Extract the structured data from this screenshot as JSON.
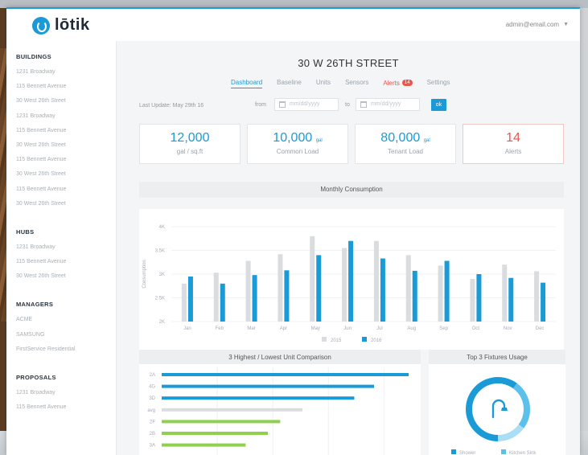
{
  "app": {
    "logo": "lōtik",
    "account": "admin@email.com"
  },
  "sidebar": {
    "sections": [
      {
        "title": "BUILDINGS",
        "items": [
          "1231 Broadway",
          "115 Bennett Avenue",
          "30 West 26th Street",
          "1231 Broadway",
          "115 Bennett Avenue",
          "30 West 26th Street",
          "115 Bennett Avenue",
          "30 West 26th Street",
          "115 Bennett Avenue",
          "30 West 26th Street"
        ]
      },
      {
        "title": "HUBS",
        "items": [
          "1231 Broadway",
          "115 Bennett Avenue",
          "30 West 26th Street"
        ]
      },
      {
        "title": "MANAGERS",
        "items": [
          "ACME",
          "SAMSUNG",
          "FirstService Residential"
        ]
      },
      {
        "title": "PROPOSALS",
        "items": [
          "1231 Broadway",
          "115 Bennett Avenue"
        ]
      }
    ]
  },
  "page": {
    "title": "30 W 26TH STREET"
  },
  "tabs": [
    {
      "label": "Dashboard",
      "active": true
    },
    {
      "label": "Baseline"
    },
    {
      "label": "Units"
    },
    {
      "label": "Sensors"
    },
    {
      "label": "Alerts",
      "badge": "14"
    },
    {
      "label": "Settings"
    }
  ],
  "filter": {
    "last_update": "Last Update: May 29th 16",
    "from_label": "from",
    "to_label": "to",
    "from_placeholder": "mm/dd/yyyy",
    "to_placeholder": "mm/dd/yyyy",
    "ok_label": "ok"
  },
  "stats": [
    {
      "value": "12,000",
      "unit": "",
      "label": "gal / sq.ft"
    },
    {
      "value": "10,000",
      "unit": "gal",
      "label": "Common Load"
    },
    {
      "value": "80,000",
      "unit": "gal",
      "label": "Tenant Load"
    },
    {
      "value": "14",
      "unit": "",
      "label": "Alerts"
    }
  ],
  "panels": {
    "monthly": "Monthly Consumption",
    "comparison": "3 Highest / Lowest Unit Comparison",
    "fixtures": "Top 3 Fixtures Usage"
  },
  "colors": {
    "accent": "#1a9bd7",
    "alert": "#e8564d",
    "gray_series": "#d9dde0",
    "green": "#8fd14f"
  },
  "chart_data": [
    {
      "type": "bar",
      "title": "Monthly Consumption",
      "ylabel": "Consumption",
      "xlabel": "",
      "categories": [
        "Jan",
        "Feb",
        "Mar",
        "Apr",
        "May",
        "Jun",
        "Jul",
        "Aug",
        "Sep",
        "Oct",
        "Nov",
        "Dec"
      ],
      "series": [
        {
          "name": "2015",
          "color": "#d9dde0",
          "values": [
            2.8,
            3.03,
            3.28,
            3.42,
            3.8,
            3.55,
            3.7,
            3.4,
            3.18,
            2.9,
            3.2,
            3.06
          ]
        },
        {
          "name": "2016",
          "color": "#1a9bd7",
          "values": [
            2.95,
            2.8,
            2.98,
            3.08,
            3.4,
            3.7,
            3.33,
            3.07,
            3.28,
            3.0,
            2.92,
            2.82
          ]
        }
      ],
      "yticks": [
        "2K",
        "2.5K",
        "3K",
        "3.5K",
        "4K"
      ],
      "ylim": [
        2.0,
        4.0
      ],
      "legend": "bottom"
    },
    {
      "type": "bar",
      "orientation": "horizontal",
      "title": "3 Highest / Lowest Unit Comparison",
      "categories": [
        "2A",
        "4G",
        "3D",
        "avg",
        "2F",
        "2B",
        "3A"
      ],
      "values": [
        100,
        86,
        78,
        57,
        48,
        43,
        34
      ],
      "colors": [
        "#1a9bd7",
        "#1a9bd7",
        "#1a9bd7",
        "#d9dde0",
        "#8fd14f",
        "#8fd14f",
        "#8fd14f"
      ],
      "xlim": [
        0,
        100
      ]
    },
    {
      "type": "pie",
      "title": "Top 3 Fixtures Usage",
      "slices": [
        {
          "name": "Shower",
          "value": 60,
          "color": "#1a9bd7"
        },
        {
          "name": "Kitchen Sink",
          "value": 25,
          "color": "#5bc0ea"
        },
        {
          "name": "",
          "value": 15,
          "color": "#a9def5"
        }
      ],
      "legend": [
        "Shower",
        "Kitchen Sink"
      ]
    }
  ]
}
